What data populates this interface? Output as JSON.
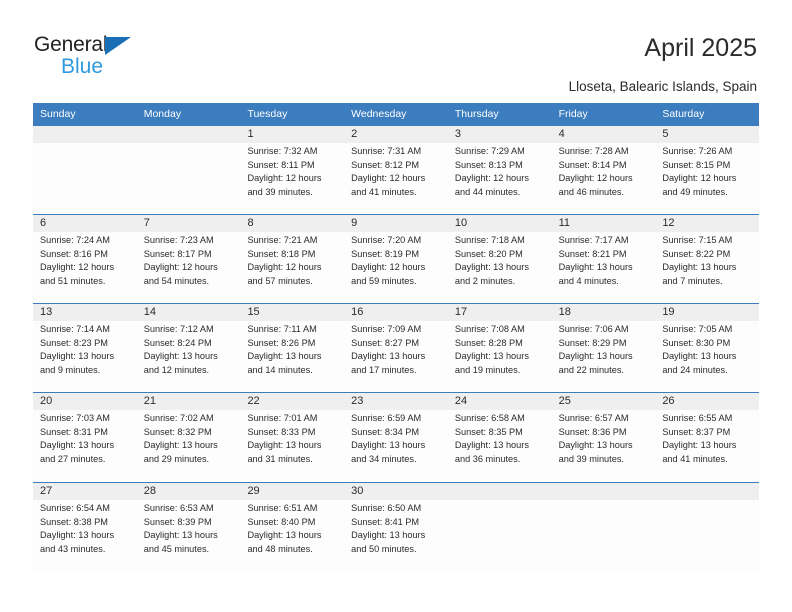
{
  "brand": {
    "name_top": "General",
    "name_bottom": "Blue"
  },
  "header": {
    "title": "April 2025",
    "location": "Lloseta, Balearic Islands, Spain"
  },
  "colors": {
    "header_blue": "#3b7dbf",
    "logo_blue": "#2e9ae0",
    "logo_triangle": "#1a6eb5",
    "num_row_bg": "#efeff0",
    "text": "#2b2b2b"
  },
  "calendar": {
    "day_names": [
      "Sunday",
      "Monday",
      "Tuesday",
      "Wednesday",
      "Thursday",
      "Friday",
      "Saturday"
    ],
    "weeks": [
      {
        "days": [
          {
            "num": "",
            "sunrise": "",
            "sunset": "",
            "daylight1": "",
            "daylight2": ""
          },
          {
            "num": "",
            "sunrise": "",
            "sunset": "",
            "daylight1": "",
            "daylight2": ""
          },
          {
            "num": "1",
            "sunrise": "Sunrise: 7:32 AM",
            "sunset": "Sunset: 8:11 PM",
            "daylight1": "Daylight: 12 hours",
            "daylight2": "and 39 minutes."
          },
          {
            "num": "2",
            "sunrise": "Sunrise: 7:31 AM",
            "sunset": "Sunset: 8:12 PM",
            "daylight1": "Daylight: 12 hours",
            "daylight2": "and 41 minutes."
          },
          {
            "num": "3",
            "sunrise": "Sunrise: 7:29 AM",
            "sunset": "Sunset: 8:13 PM",
            "daylight1": "Daylight: 12 hours",
            "daylight2": "and 44 minutes."
          },
          {
            "num": "4",
            "sunrise": "Sunrise: 7:28 AM",
            "sunset": "Sunset: 8:14 PM",
            "daylight1": "Daylight: 12 hours",
            "daylight2": "and 46 minutes."
          },
          {
            "num": "5",
            "sunrise": "Sunrise: 7:26 AM",
            "sunset": "Sunset: 8:15 PM",
            "daylight1": "Daylight: 12 hours",
            "daylight2": "and 49 minutes."
          }
        ]
      },
      {
        "days": [
          {
            "num": "6",
            "sunrise": "Sunrise: 7:24 AM",
            "sunset": "Sunset: 8:16 PM",
            "daylight1": "Daylight: 12 hours",
            "daylight2": "and 51 minutes."
          },
          {
            "num": "7",
            "sunrise": "Sunrise: 7:23 AM",
            "sunset": "Sunset: 8:17 PM",
            "daylight1": "Daylight: 12 hours",
            "daylight2": "and 54 minutes."
          },
          {
            "num": "8",
            "sunrise": "Sunrise: 7:21 AM",
            "sunset": "Sunset: 8:18 PM",
            "daylight1": "Daylight: 12 hours",
            "daylight2": "and 57 minutes."
          },
          {
            "num": "9",
            "sunrise": "Sunrise: 7:20 AM",
            "sunset": "Sunset: 8:19 PM",
            "daylight1": "Daylight: 12 hours",
            "daylight2": "and 59 minutes."
          },
          {
            "num": "10",
            "sunrise": "Sunrise: 7:18 AM",
            "sunset": "Sunset: 8:20 PM",
            "daylight1": "Daylight: 13 hours",
            "daylight2": "and 2 minutes."
          },
          {
            "num": "11",
            "sunrise": "Sunrise: 7:17 AM",
            "sunset": "Sunset: 8:21 PM",
            "daylight1": "Daylight: 13 hours",
            "daylight2": "and 4 minutes."
          },
          {
            "num": "12",
            "sunrise": "Sunrise: 7:15 AM",
            "sunset": "Sunset: 8:22 PM",
            "daylight1": "Daylight: 13 hours",
            "daylight2": "and 7 minutes."
          }
        ]
      },
      {
        "days": [
          {
            "num": "13",
            "sunrise": "Sunrise: 7:14 AM",
            "sunset": "Sunset: 8:23 PM",
            "daylight1": "Daylight: 13 hours",
            "daylight2": "and 9 minutes."
          },
          {
            "num": "14",
            "sunrise": "Sunrise: 7:12 AM",
            "sunset": "Sunset: 8:24 PM",
            "daylight1": "Daylight: 13 hours",
            "daylight2": "and 12 minutes."
          },
          {
            "num": "15",
            "sunrise": "Sunrise: 7:11 AM",
            "sunset": "Sunset: 8:26 PM",
            "daylight1": "Daylight: 13 hours",
            "daylight2": "and 14 minutes."
          },
          {
            "num": "16",
            "sunrise": "Sunrise: 7:09 AM",
            "sunset": "Sunset: 8:27 PM",
            "daylight1": "Daylight: 13 hours",
            "daylight2": "and 17 minutes."
          },
          {
            "num": "17",
            "sunrise": "Sunrise: 7:08 AM",
            "sunset": "Sunset: 8:28 PM",
            "daylight1": "Daylight: 13 hours",
            "daylight2": "and 19 minutes."
          },
          {
            "num": "18",
            "sunrise": "Sunrise: 7:06 AM",
            "sunset": "Sunset: 8:29 PM",
            "daylight1": "Daylight: 13 hours",
            "daylight2": "and 22 minutes."
          },
          {
            "num": "19",
            "sunrise": "Sunrise: 7:05 AM",
            "sunset": "Sunset: 8:30 PM",
            "daylight1": "Daylight: 13 hours",
            "daylight2": "and 24 minutes."
          }
        ]
      },
      {
        "days": [
          {
            "num": "20",
            "sunrise": "Sunrise: 7:03 AM",
            "sunset": "Sunset: 8:31 PM",
            "daylight1": "Daylight: 13 hours",
            "daylight2": "and 27 minutes."
          },
          {
            "num": "21",
            "sunrise": "Sunrise: 7:02 AM",
            "sunset": "Sunset: 8:32 PM",
            "daylight1": "Daylight: 13 hours",
            "daylight2": "and 29 minutes."
          },
          {
            "num": "22",
            "sunrise": "Sunrise: 7:01 AM",
            "sunset": "Sunset: 8:33 PM",
            "daylight1": "Daylight: 13 hours",
            "daylight2": "and 31 minutes."
          },
          {
            "num": "23",
            "sunrise": "Sunrise: 6:59 AM",
            "sunset": "Sunset: 8:34 PM",
            "daylight1": "Daylight: 13 hours",
            "daylight2": "and 34 minutes."
          },
          {
            "num": "24",
            "sunrise": "Sunrise: 6:58 AM",
            "sunset": "Sunset: 8:35 PM",
            "daylight1": "Daylight: 13 hours",
            "daylight2": "and 36 minutes."
          },
          {
            "num": "25",
            "sunrise": "Sunrise: 6:57 AM",
            "sunset": "Sunset: 8:36 PM",
            "daylight1": "Daylight: 13 hours",
            "daylight2": "and 39 minutes."
          },
          {
            "num": "26",
            "sunrise": "Sunrise: 6:55 AM",
            "sunset": "Sunset: 8:37 PM",
            "daylight1": "Daylight: 13 hours",
            "daylight2": "and 41 minutes."
          }
        ]
      },
      {
        "days": [
          {
            "num": "27",
            "sunrise": "Sunrise: 6:54 AM",
            "sunset": "Sunset: 8:38 PM",
            "daylight1": "Daylight: 13 hours",
            "daylight2": "and 43 minutes."
          },
          {
            "num": "28",
            "sunrise": "Sunrise: 6:53 AM",
            "sunset": "Sunset: 8:39 PM",
            "daylight1": "Daylight: 13 hours",
            "daylight2": "and 45 minutes."
          },
          {
            "num": "29",
            "sunrise": "Sunrise: 6:51 AM",
            "sunset": "Sunset: 8:40 PM",
            "daylight1": "Daylight: 13 hours",
            "daylight2": "and 48 minutes."
          },
          {
            "num": "30",
            "sunrise": "Sunrise: 6:50 AM",
            "sunset": "Sunset: 8:41 PM",
            "daylight1": "Daylight: 13 hours",
            "daylight2": "and 50 minutes."
          },
          {
            "num": "",
            "sunrise": "",
            "sunset": "",
            "daylight1": "",
            "daylight2": ""
          },
          {
            "num": "",
            "sunrise": "",
            "sunset": "",
            "daylight1": "",
            "daylight2": ""
          },
          {
            "num": "",
            "sunrise": "",
            "sunset": "",
            "daylight1": "",
            "daylight2": ""
          }
        ]
      }
    ]
  }
}
